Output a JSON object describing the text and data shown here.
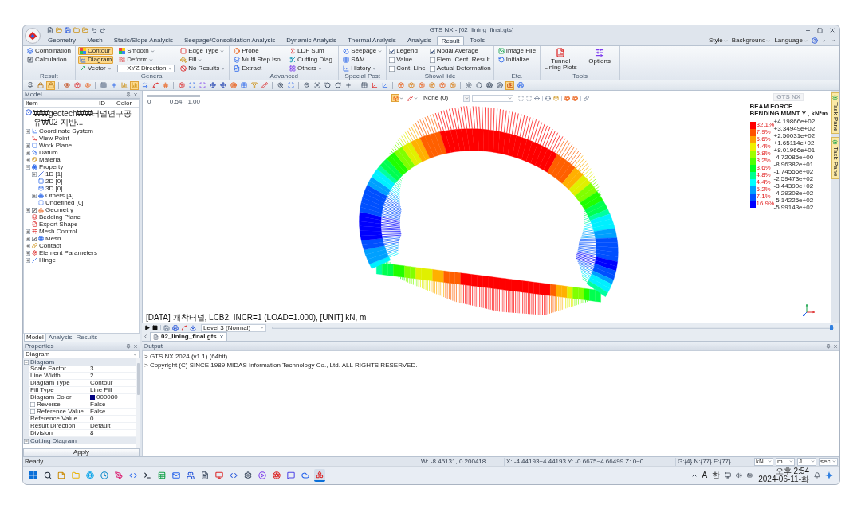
{
  "window": {
    "title": "GTS NX - [02_lining_final.gts]"
  },
  "ribbon_tabs": [
    {
      "label": "Geometry",
      "selected": false
    },
    {
      "label": "Mesh",
      "selected": false
    },
    {
      "label": "Static/Slope Analysis",
      "selected": false
    },
    {
      "label": "Seepage/Consolidation Analysis",
      "selected": false
    },
    {
      "label": "Dynamic Analysis",
      "selected": false
    },
    {
      "label": "Thermal Analysis",
      "selected": false
    },
    {
      "label": "Analysis",
      "selected": false
    },
    {
      "label": "Result",
      "selected": true
    },
    {
      "label": "Tools",
      "selected": false
    }
  ],
  "ribbon_menus": [
    "Style",
    "Background",
    "Language"
  ],
  "ribbon_groups": [
    {
      "title": "Result",
      "items": [
        {
          "kind": "button",
          "label": "Combination",
          "selected": false
        },
        {
          "kind": "button",
          "label": "Calculation",
          "selected": false
        }
      ]
    },
    {
      "title": "General",
      "items": [
        {
          "kind": "button",
          "label": "Contour",
          "selected": true
        },
        {
          "kind": "button",
          "label": "Diagram",
          "selected": true
        },
        {
          "kind": "button",
          "label": "Vector",
          "selected": false,
          "dropdown": true
        },
        {
          "kind": "button",
          "label": "Smooth",
          "selected": false,
          "dropdown": true
        },
        {
          "kind": "button",
          "label": "Deform",
          "selected": false,
          "dropdown": true
        },
        {
          "kind": "combo",
          "value": "XYZ Direction"
        },
        {
          "kind": "button",
          "label": "Edge Type",
          "selected": false,
          "dropdown": true
        },
        {
          "kind": "button",
          "label": "Fill",
          "selected": false,
          "dropdown": true
        },
        {
          "kind": "button",
          "label": "No Results",
          "selected": false,
          "dropdown": true
        }
      ]
    },
    {
      "title": "Advanced",
      "items": [
        {
          "kind": "button",
          "label": "Probe",
          "selected": false
        },
        {
          "kind": "button",
          "label": "Multi Step Iso.",
          "selected": false
        },
        {
          "kind": "button",
          "label": "Extract",
          "selected": false
        },
        {
          "kind": "button",
          "label": "LDF Sum",
          "selected": false
        },
        {
          "kind": "button",
          "label": "Cutting Diag.",
          "selected": false
        },
        {
          "kind": "button",
          "label": "Others",
          "selected": false,
          "dropdown": true
        }
      ]
    },
    {
      "title": "Special Post",
      "items": [
        {
          "kind": "button",
          "label": "Seepage",
          "selected": false,
          "dropdown": true
        },
        {
          "kind": "button",
          "label": "SAM",
          "selected": false
        },
        {
          "kind": "button",
          "label": "History",
          "selected": false,
          "dropdown": true
        }
      ]
    },
    {
      "title": "Show/Hide",
      "items": [
        {
          "kind": "checkbox",
          "label": "Legend",
          "checked": true
        },
        {
          "kind": "checkbox",
          "label": "Value",
          "checked": false
        },
        {
          "kind": "checkbox",
          "label": "Cont. Line",
          "checked": false
        },
        {
          "kind": "checkbox",
          "label": "Nodal Average",
          "checked": true
        },
        {
          "kind": "checkbox",
          "label": "Elem. Cent. Result",
          "checked": false
        },
        {
          "kind": "checkbox",
          "label": "Actual Deformation",
          "checked": false
        }
      ]
    },
    {
      "title": "Etc.",
      "items": [
        {
          "kind": "button",
          "label": "Image File",
          "selected": false
        },
        {
          "kind": "button",
          "label": "Initialize",
          "selected": false
        }
      ]
    },
    {
      "title": "Tools",
      "items": [
        {
          "kind": "large",
          "label": "Tunnel Lining Plots",
          "selected": false
        },
        {
          "kind": "large",
          "label": "Options",
          "selected": false
        }
      ]
    }
  ],
  "toolbar": [
    {
      "on": false
    },
    {
      "on": false
    },
    {
      "on": true
    },
    {
      "on": false
    },
    {
      "on": false
    },
    {
      "on": false
    },
    {
      "on": false
    },
    {
      "on": false
    },
    {
      "on": false
    },
    {
      "on": true
    },
    {
      "on": false
    },
    {
      "on": false
    },
    {
      "on": false
    },
    {
      "on": false
    },
    {
      "on": false
    },
    {
      "on": false
    },
    {
      "on": false
    },
    {
      "on": false
    },
    {
      "on": false
    },
    {
      "on": false
    },
    {
      "on": false
    },
    {
      "on": false
    },
    {
      "on": false
    },
    {
      "on": false
    },
    {
      "on": false
    },
    {
      "on": false
    },
    {
      "on": false
    },
    {
      "on": false
    },
    {
      "on": false
    },
    {
      "on": false
    },
    {
      "on": false
    },
    {
      "on": false
    },
    {
      "on": false
    },
    {
      "on": false
    },
    {
      "on": false
    },
    {
      "on": false
    },
    {
      "on": false
    },
    {
      "on": false
    },
    {
      "on": false
    },
    {
      "on": false
    },
    {
      "on": false
    },
    {
      "on": false
    },
    {
      "on": true
    },
    {
      "on": false
    }
  ],
  "model_panel": {
    "title": "Model",
    "columns": [
      "Item",
      "ID",
      "Color"
    ],
    "tree": [
      {
        "label": "₩₩geotech₩₩터널연구공유₩02-지반...",
        "children": [
          {
            "label": "Coordinate System",
            "expanded": false
          },
          {
            "label": "View Point"
          },
          {
            "label": "Work Plane",
            "expanded": false
          },
          {
            "label": "Datum",
            "expanded": false
          },
          {
            "label": "Material",
            "expanded": false
          },
          {
            "label": "Property",
            "expanded": true,
            "children": [
              {
                "label": "1D [1]",
                "expanded": false
              },
              {
                "label": "2D [0]"
              },
              {
                "label": "3D [0]"
              },
              {
                "label": "Others [4]",
                "expanded": false
              },
              {
                "label": "Undefined [0]"
              }
            ]
          },
          {
            "label": "Geometry",
            "expanded": false,
            "checked": true
          },
          {
            "label": "Bedding Plane"
          },
          {
            "label": "Export Shape"
          },
          {
            "label": "Mesh Control",
            "expanded": false
          },
          {
            "label": "Mesh",
            "expanded": false,
            "checked": true
          },
          {
            "label": "Contact",
            "expanded": false
          },
          {
            "label": "Element Parameters",
            "expanded": false
          },
          {
            "label": "Hinge",
            "expanded": false
          }
        ]
      }
    ]
  },
  "panel_tabs": [
    {
      "label": "Model",
      "selected": true
    },
    {
      "label": "Analysis",
      "selected": false
    },
    {
      "label": "Results",
      "selected": false
    }
  ],
  "properties": {
    "title": "Properties",
    "selector": "Diagram",
    "sections": [
      {
        "title": "Diagram",
        "expanded": true,
        "rows": [
          {
            "name": "Scale Factor",
            "value": "3"
          },
          {
            "name": "Line Width",
            "value": "2"
          },
          {
            "name": "Diagram Type",
            "value": "Contour"
          },
          {
            "name": "Fill Type",
            "value": "Line Fill"
          },
          {
            "name": "Diagram Color",
            "value": "000080",
            "color": "#000080"
          },
          {
            "name": "Reverse",
            "value": "False",
            "checked": false
          },
          {
            "name": "Reference Value",
            "value": "False",
            "checked": false
          },
          {
            "name": "Reference Value",
            "value": "0"
          },
          {
            "name": "Result Direction",
            "value": "Default"
          },
          {
            "name": "Division",
            "value": "8"
          }
        ]
      },
      {
        "title": "Cutting Diagram",
        "expanded": true
      }
    ],
    "apply": "Apply"
  },
  "viewport": {
    "transparency": {
      "labels": [
        "0",
        "0.54",
        "1.00"
      ],
      "level": 0.54
    },
    "view_tools": [
      {
        "on": true
      },
      {
        "on": false
      }
    ],
    "view_filter": "None (0)",
    "logo": "GTS NX",
    "legend": {
      "title": "BEAM FORCE",
      "subtitle": "BENDING MMNT Y , kN*m",
      "values": [
        "+4.19866e+02",
        "+3.34949e+02",
        "+2.50031e+02",
        "+1.65114e+02",
        "+8.01966e+01",
        "-4.72085e+00",
        "-8.96382e+01",
        "-1.74556e+02",
        "-2.59473e+02",
        "-3.44390e+02",
        "-4.29308e+02",
        "-5.14225e+02",
        "-5.99143e+02"
      ],
      "bands": [
        {
          "percent": "32.1%",
          "color": "#ff0000"
        },
        {
          "percent": "7.9%",
          "color": "#ff5000"
        },
        {
          "percent": "5.6%",
          "color": "#ffa000"
        },
        {
          "percent": "4.4%",
          "color": "#f0f000"
        },
        {
          "percent": "5.8%",
          "color": "#a0ff00"
        },
        {
          "percent": "3.2%",
          "color": "#50ff00"
        },
        {
          "percent": "3.6%",
          "color": "#00ff20"
        },
        {
          "percent": "4.8%",
          "color": "#00ff90"
        },
        {
          "percent": "4.4%",
          "color": "#00ffff"
        },
        {
          "percent": "5.2%",
          "color": "#00a0ff"
        },
        {
          "percent": "7.1%",
          "color": "#0050ff"
        },
        {
          "percent": "16.9%",
          "color": "#0000ff"
        }
      ]
    },
    "data_line": "[DATA] 개착터널, LCB2, INCR=1 (LOAD=1.000), [UNIT] kN, m"
  },
  "animation_bar": {
    "level_select": "Level 3 (Normal)",
    "level": 1
  },
  "document_tabs": [
    {
      "label": "02_lining_final.gts",
      "selected": true
    }
  ],
  "task_pane_tabs": [
    "Task Pane",
    "Task Pane"
  ],
  "output": {
    "title": "Output",
    "lines": [
      "> GTS NX 2024 (v1.1) (64bit)",
      "> Copyright (C) SINCE 1989 MIDAS Information Technology Co., Ltd. ALL RIGHTS RESERVED."
    ]
  },
  "status_bar": {
    "message": "Ready",
    "fields": [
      "W: -8.45131, 0.200418",
      "X: -4.44193~4.44193 Y: -0.6675~4.66499 Z: 0~0",
      "G:{4} N:{77} E:{77}"
    ],
    "units": [
      "kN",
      "m",
      "J",
      "sec"
    ]
  },
  "taskbar": {
    "apps": [
      {
        "selected": false
      },
      {
        "selected": false
      },
      {
        "selected": false
      },
      {
        "selected": false
      },
      {
        "selected": false
      },
      {
        "selected": false
      },
      {
        "selected": false
      },
      {
        "selected": false
      },
      {
        "selected": false
      },
      {
        "selected": false
      },
      {
        "selected": false
      },
      {
        "selected": false
      },
      {
        "selected": false
      },
      {
        "selected": false
      },
      {
        "selected": false
      },
      {
        "selected": false
      },
      {
        "selected": false
      },
      {
        "selected": false
      },
      {
        "selected": true
      }
    ],
    "tray_labels": [
      "A",
      "한"
    ],
    "time": "오후 2:54",
    "date": "2024-06-11-화"
  }
}
